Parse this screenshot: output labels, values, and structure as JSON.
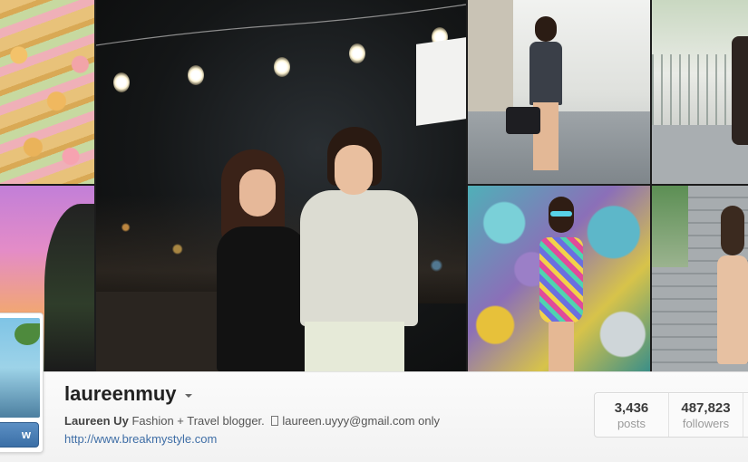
{
  "profile": {
    "username": "laureenmuy",
    "bio_name": "Laureen Uy",
    "bio_text": "Fashion + Travel blogger.",
    "bio_email_text": "laureen.uyyy@gmail.com only",
    "website": "http://www.breakmystyle.com",
    "follow_label": "w"
  },
  "stats": [
    {
      "value": "3,436",
      "label": "posts"
    },
    {
      "value": "487,823",
      "label": "followers"
    }
  ],
  "icons": {
    "dropdown": "caret-down-icon",
    "email": "mail-icon"
  },
  "colors": {
    "link": "#3f6ea6",
    "follow_button": "#4a7fb5"
  }
}
